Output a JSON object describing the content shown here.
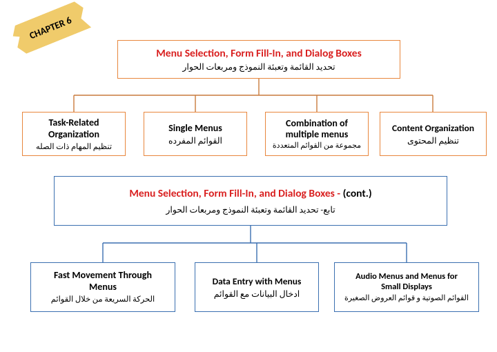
{
  "chapter_label": "CHAPTER 6",
  "top": {
    "title_en": "Menu Selection, Form Fill-In, and Dialog Boxes",
    "title_ar": "تحديد القائمة وتعبئة النموذج ومربعات الحوار"
  },
  "row1": [
    {
      "en1": "Task-Related",
      "en2": "Organization",
      "ar": "تنظيم المهام ذات الصله"
    },
    {
      "en1": "Single Menus",
      "en2": "",
      "ar": "القوائم المفرده"
    },
    {
      "en1": "Combination of",
      "en2": "multiple menus",
      "ar": "مجموعة من القوائم المتعددة"
    },
    {
      "en1": "Content Organization",
      "en2": "",
      "ar": "تنظيم المحتوى"
    }
  ],
  "mid": {
    "title_en": "Menu Selection, Form Fill-In, and Dialog Boxes - ",
    "cont": "(cont.)",
    "title_ar": "تابع-  تحديد القائمة وتعبئة النموذج ومربعات الحوار"
  },
  "row2": [
    {
      "en1": "Fast Movement Through",
      "en2": "Menus",
      "ar": "الحركة السريعة من خلال القوائم"
    },
    {
      "en1": "Data Entry with Menus",
      "en2": "",
      "ar": "ادخال البيانات مع القوائم"
    },
    {
      "en1": "Audio Menus and Menus for",
      "en2": "Small Displays",
      "ar": "القوائم الصوتية و قوائم العروض الصغيرة"
    }
  ]
}
